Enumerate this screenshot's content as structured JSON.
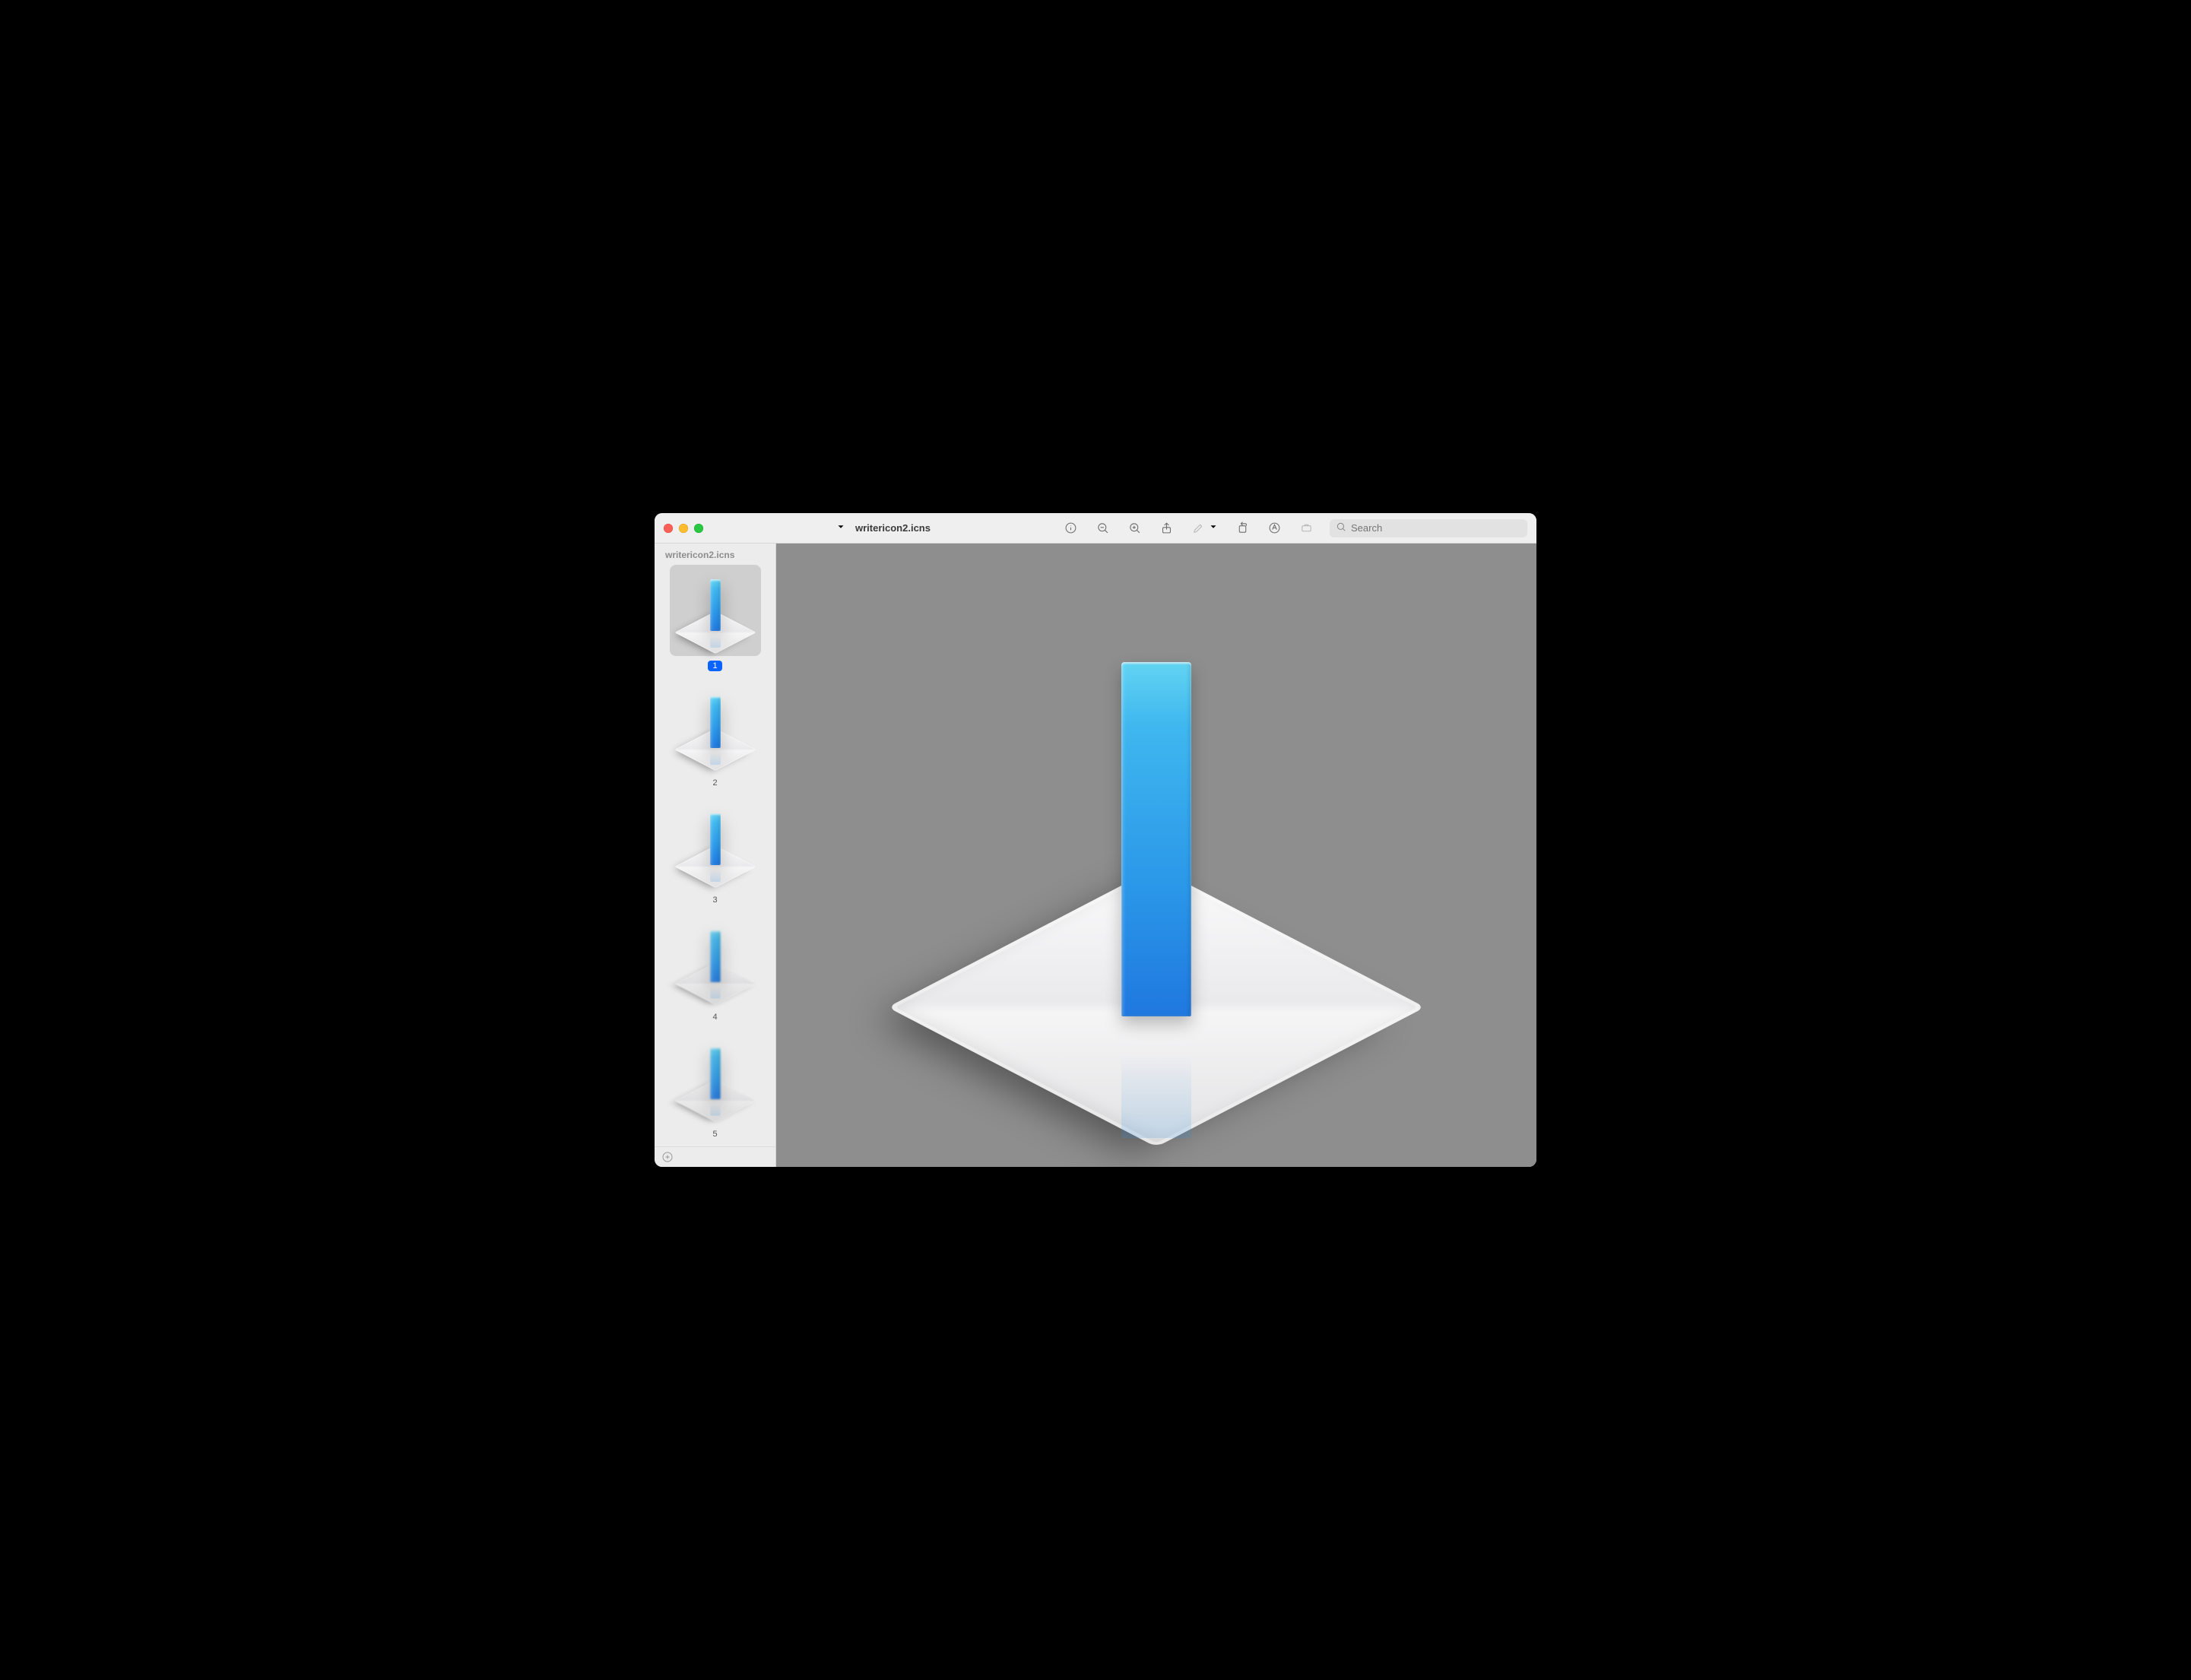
{
  "window": {
    "title": "writericon2.icns"
  },
  "toolbar": {
    "sidebar_toggle": "sidebar-toggle",
    "dropdown_aria": "view options"
  },
  "search": {
    "placeholder": "Search",
    "value": ""
  },
  "sidebar": {
    "title": "writericon2.icns",
    "items": [
      {
        "label": "1",
        "selected": true,
        "pixelated": false
      },
      {
        "label": "2",
        "selected": false,
        "pixelated": false
      },
      {
        "label": "3",
        "selected": false,
        "pixelated": false
      },
      {
        "label": "4",
        "selected": false,
        "pixelated": true
      },
      {
        "label": "5",
        "selected": false,
        "pixelated": true
      }
    ]
  },
  "icons": {
    "sidebar": "sidebar-icon",
    "chevron_down": "chevron-down-icon",
    "info": "info-icon",
    "zoom_out": "zoom-out-icon",
    "zoom_in": "zoom-in-icon",
    "share": "share-icon",
    "markup": "markup-icon",
    "rotate": "rotate-icon",
    "highlight": "highlight-icon",
    "toolbox": "toolbox-icon",
    "search": "search-icon",
    "add": "add-icon"
  }
}
